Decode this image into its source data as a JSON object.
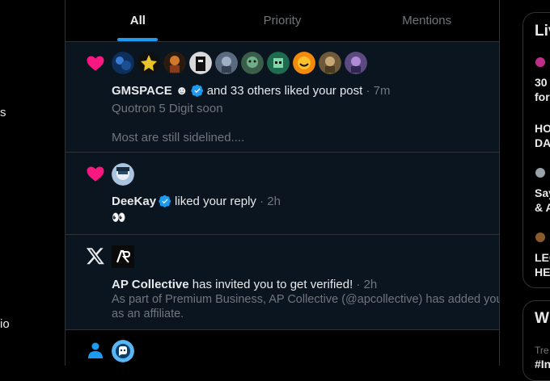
{
  "left_nav": {
    "frag1": "s",
    "frag2": "io"
  },
  "tabs": [
    {
      "label": "All",
      "active": true
    },
    {
      "label": "Priority",
      "active": false
    },
    {
      "label": "Mentions",
      "active": false
    }
  ],
  "notifications": [
    {
      "type": "like",
      "icon": "heart-icon",
      "actor": "GMSPACE ☻",
      "action": "and 33 others liked your post",
      "time": "· 7m",
      "preview": "Quotron 5 Digit soon",
      "preview2": "Most are still sidelined...."
    },
    {
      "type": "like",
      "icon": "heart-icon",
      "actor": "DeeKay",
      "action": "liked your reply",
      "time": "· 2h",
      "preview": "👀"
    },
    {
      "type": "verification",
      "icon": "x-logo-icon",
      "actor": "AP Collective",
      "action": "has invited you to get verified!",
      "time": "· 2h",
      "body_line1": "As part of Premium Business, AP Collective (@apcollective) has added you",
      "body_line2": "as an affiliate."
    },
    {
      "type": "follow",
      "icon": "person-icon"
    }
  ],
  "right_sidebar": {
    "section1_title": "Liv",
    "item1_line1": "30",
    "item1_line2": "for",
    "item2_line1": "HO",
    "item2_line2": "DA",
    "item3_line1": "Say",
    "item3_line2": "& A",
    "item4_line1": "LEG",
    "item4_line2": "HE",
    "section2_title": "Wh",
    "section2_sub": "Tre",
    "section2_tag": "#In"
  },
  "colors": {
    "accent": "#1d9bf0",
    "like": "#f91880",
    "unread_bg": "#0a1520",
    "border": "#2f3336"
  }
}
